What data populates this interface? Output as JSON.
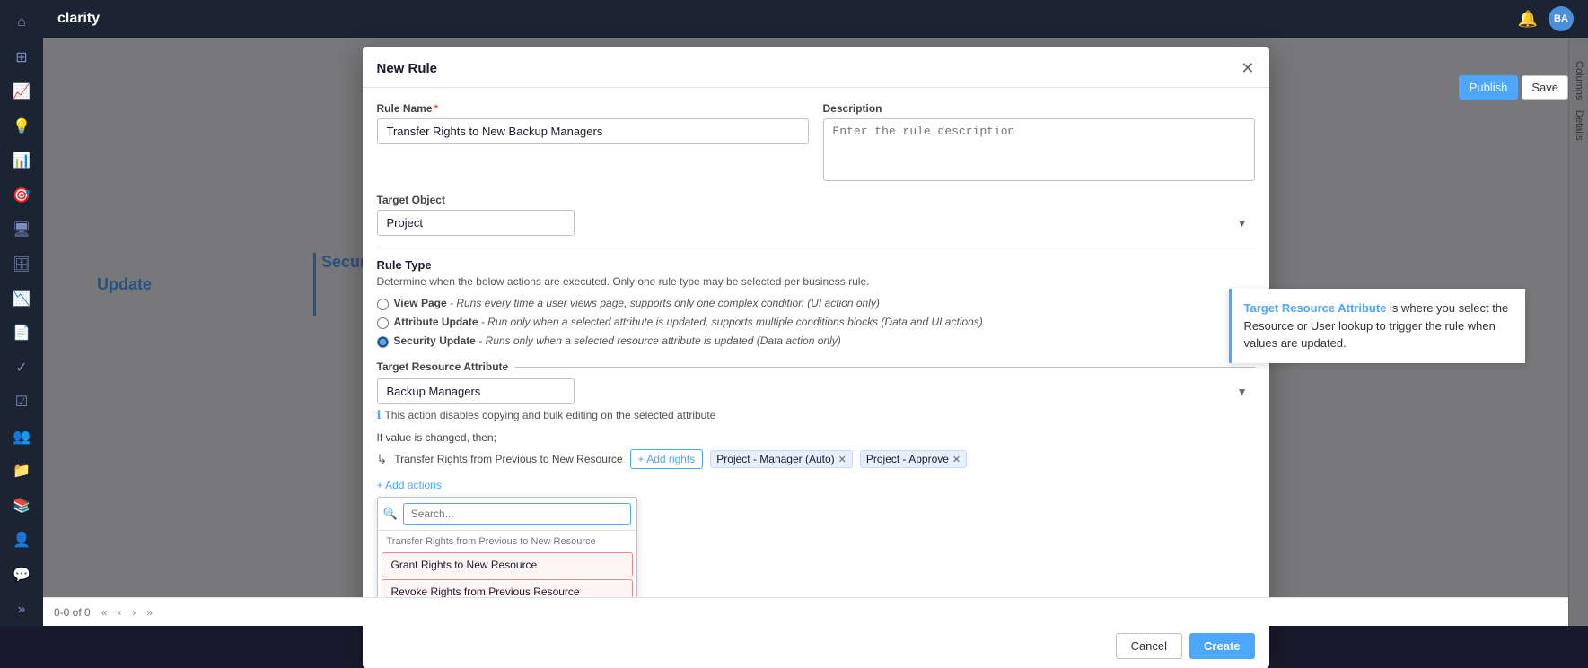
{
  "app": {
    "title": "clarity"
  },
  "sidebar": {
    "icons": [
      "home",
      "grid",
      "chart-line",
      "lightbulb",
      "bar-chart",
      "target",
      "monitor",
      "database",
      "trending",
      "file",
      "check",
      "checklist",
      "org-chart",
      "folder",
      "book",
      "users",
      "message",
      "chevron-down"
    ]
  },
  "page": {
    "update_label": "Update",
    "security_label": "Security"
  },
  "right_panel": {
    "columns_label": "Columns",
    "details_label": "Details"
  },
  "top_bar": {
    "publish_label": "Publish",
    "save_label": "Save"
  },
  "modal": {
    "title": "New Rule",
    "rule_name_label": "Rule Name",
    "rule_name_required": "*",
    "rule_name_value": "Transfer Rights to New Backup Managers",
    "description_label": "Description",
    "description_placeholder": "Enter the rule description",
    "target_object_label": "Target Object",
    "target_object_value": "Project",
    "rule_type_title": "Rule Type",
    "rule_type_desc": "Determine when the below actions are executed. Only one rule type may be selected per business rule.",
    "radio_options": [
      {
        "id": "view-page",
        "label": "View Page",
        "desc": " - Runs every time a user views page, supports only one complex condition (UI action only)",
        "checked": false
      },
      {
        "id": "attribute-update",
        "label": "Attribute Update",
        "desc": " - Run only when a selected attribute is updated, supports multiple conditions blocks (Data and UI actions)",
        "checked": false
      },
      {
        "id": "security-update",
        "label": "Security Update",
        "desc": " - Runs only when a selected resource attribute is updated (Data action only)",
        "checked": true
      }
    ],
    "target_resource_attr_label": "Target Resource Attribute",
    "target_resource_attr_value": "Backup Managers",
    "info_message": "This action disables copying and bulk editing on the selected attribute",
    "condition_label": "If value is changed, then;",
    "action_label": "Transfer Rights from Previous to New Resource",
    "add_rights_btn": "+ Add rights",
    "tags": [
      {
        "label": "Project - Manager (Auto)"
      },
      {
        "label": "Project - Approve"
      }
    ],
    "add_actions_btn": "+ Add actions",
    "search_placeholder": "Search...",
    "dropdown_section_label": "Transfer Rights from Previous to New Resource",
    "dropdown_items": [
      {
        "label": "Grant Rights to New Resource",
        "highlighted": true
      },
      {
        "label": "Revoke Rights from Previous Resource",
        "highlighted": true
      }
    ],
    "tooltip": {
      "highlight": "Target Resource Attribute",
      "text": " is where you select the Resource or User lookup to trigger the rule when values are updated."
    },
    "cancel_btn": "Cancel",
    "create_btn": "Create"
  },
  "bottom_bar": {
    "count": "0-0 of 0",
    "pagination_btns": [
      "<<",
      "<",
      ">",
      ">>"
    ]
  }
}
